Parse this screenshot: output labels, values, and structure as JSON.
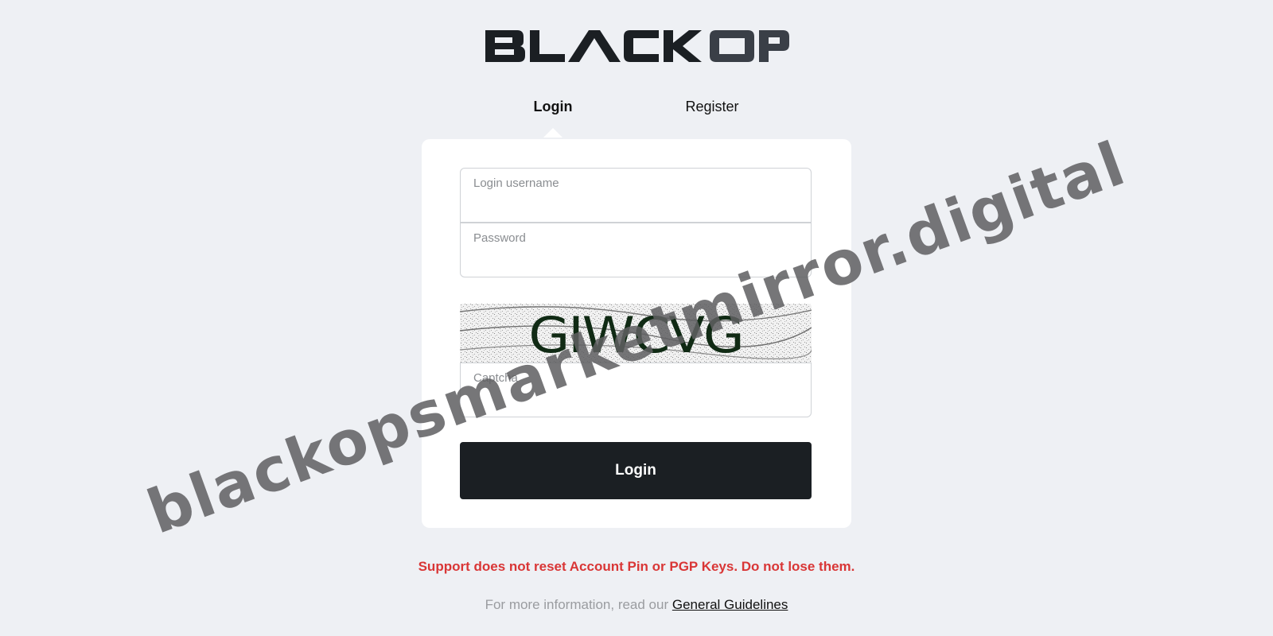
{
  "brand": {
    "logo_text": "BLACK OPS",
    "colors": {
      "black": "#1b1f23",
      "ops_gray": "#3a3f47"
    }
  },
  "tabs": [
    {
      "label": "Login",
      "active": true
    },
    {
      "label": "Register",
      "active": false
    }
  ],
  "form": {
    "username_placeholder": "Login username",
    "password_placeholder": "Password",
    "captcha_text": "GIWCVG",
    "captcha_placeholder": "Captcha",
    "submit_label": "Login"
  },
  "footer": {
    "warning": "Support does not reset Account Pin or PGP Keys. Do not lose them.",
    "info_prefix": "For more information, read our ",
    "info_link": "General Guidelines"
  },
  "watermark": "blackopsmarketmirror.digital",
  "colors": {
    "background": "#eef0f4",
    "card": "#ffffff",
    "button": "#1b1f23",
    "warning": "#d93636"
  }
}
